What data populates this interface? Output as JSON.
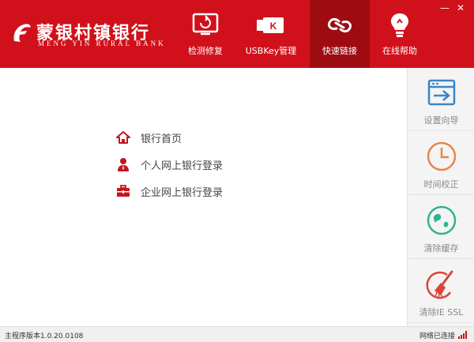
{
  "app": {
    "name": "蒙银村镇银行",
    "name_en": "MENG  YIN  RURAL  BANK"
  },
  "window": {
    "minimize_glyph": "—",
    "close_glyph": "✕"
  },
  "nav": {
    "items": [
      {
        "label": "检测修复",
        "icon": "monitor-repair-icon"
      },
      {
        "label": "USBKey管理",
        "icon": "usbkey-icon",
        "key_letter": "K"
      },
      {
        "label": "快速链接",
        "icon": "quick-link-icon",
        "active": true
      },
      {
        "label": "在线帮助",
        "icon": "lightbulb-help-icon"
      }
    ]
  },
  "links": [
    {
      "label": "银行首页",
      "icon": "home-icon"
    },
    {
      "label": "个人网上银行登录",
      "icon": "person-icon"
    },
    {
      "label": "企业网上银行登录",
      "icon": "briefcase-icon"
    }
  ],
  "tools": [
    {
      "label": "设置向导",
      "icon": "setup-wizard-icon"
    },
    {
      "label": "时间校正",
      "icon": "clock-icon"
    },
    {
      "label": "清除缓存",
      "icon": "clear-cache-icon"
    },
    {
      "label": "清除IE SSL",
      "icon": "broom-icon"
    }
  ],
  "status": {
    "version": "主程序版本1.0.20.0108",
    "network": "网络已连接"
  },
  "colors": {
    "brand_red": "#d0111b",
    "active_red": "#9e0c12",
    "tool_blue": "#3a86c8",
    "tool_orange": "#e8844a",
    "tool_teal": "#2fb38f",
    "tool_red": "#d9463c"
  }
}
